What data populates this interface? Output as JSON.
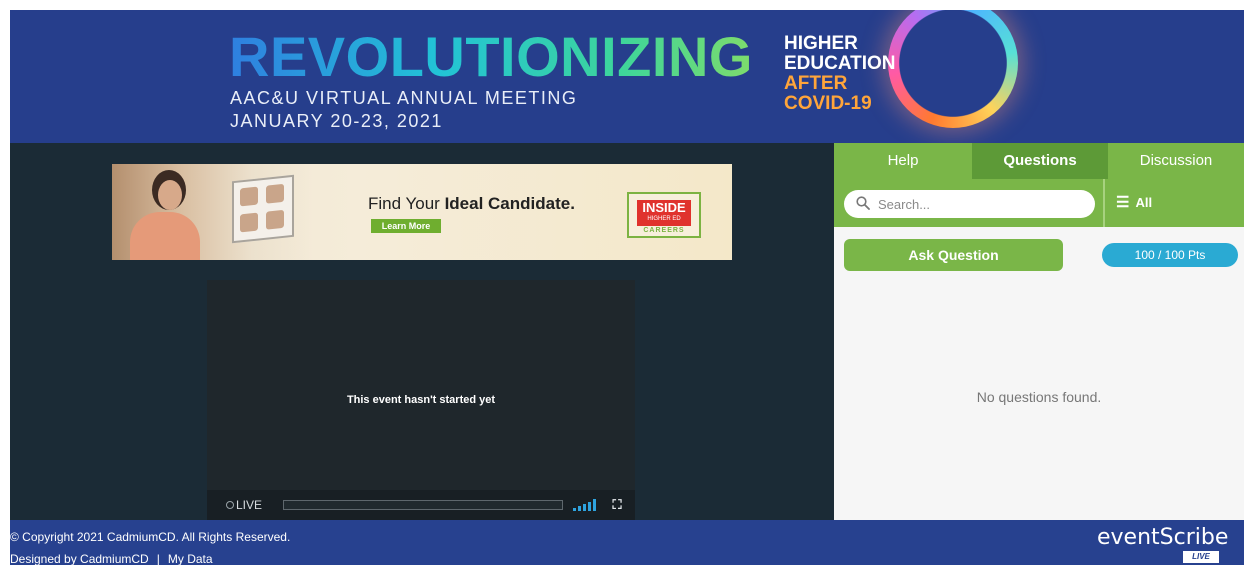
{
  "banner": {
    "title": "REVOLUTIONIZING",
    "subtitle_line1": "AAC&U VIRTUAL ANNUAL MEETING",
    "subtitle_line2": "JANUARY 20-23, 2021",
    "right_line1": "HIGHER",
    "right_line2": "EDUCATION",
    "right_line3": "AFTER",
    "right_line4": "COVID-19"
  },
  "ad": {
    "headline_prefix": "Find Your ",
    "headline_bold": "Ideal Candidate.",
    "button": "Learn More",
    "logo_main": "INSIDE",
    "logo_small": "HIGHER ED",
    "logo_careers": "CAREERS"
  },
  "player": {
    "message": "This event hasn't started yet",
    "live_label": "LIVE"
  },
  "panel": {
    "tabs": [
      {
        "label": "Help"
      },
      {
        "label": "Questions"
      },
      {
        "label": "Discussion"
      }
    ],
    "search": {
      "placeholder": "Search..."
    },
    "filter_label": "All",
    "ask_button": "Ask Question",
    "points": "100 / 100 Pts",
    "empty_message": "No questions found."
  },
  "footer": {
    "copyright": "© Copyright 2021 CadmiumCD. All Rights Reserved.",
    "designed_by": "Designed by CadmiumCD",
    "separator": "|",
    "my_data": "My Data",
    "brand": "eventScribe",
    "brand_badge": "LIVE"
  },
  "colors": {
    "banner_bg": "#263e8c",
    "accent_green": "#7ab648",
    "active_tab": "#5d9a37",
    "points_blue": "#2aaad3",
    "stage_bg": "#1b2b36",
    "footer_bg": "#27418f"
  }
}
